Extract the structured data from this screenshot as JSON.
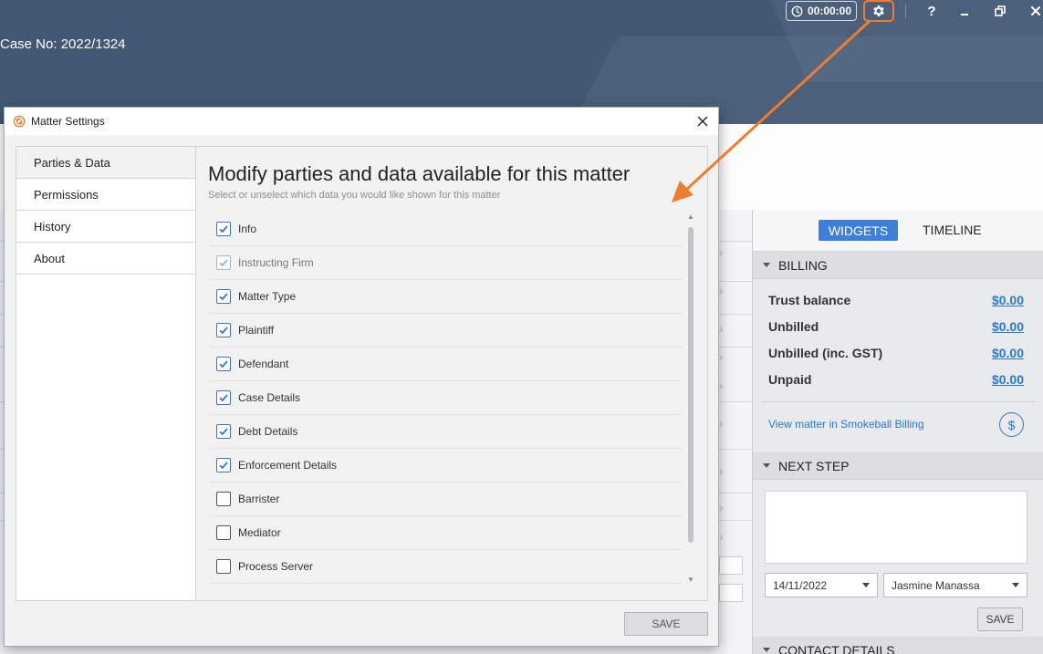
{
  "header": {
    "case_no": "Case No: 2022/1324",
    "timer": "00:00:00",
    "help": "?"
  },
  "dialog": {
    "title": "Matter Settings",
    "nav": [
      {
        "label": "Parties & Data",
        "active": true
      },
      {
        "label": "Permissions"
      },
      {
        "label": "History"
      },
      {
        "label": "About"
      }
    ],
    "heading": "Modify parties and data available for this matter",
    "subheading": "Select or unselect which data you would like shown for this matter",
    "items": [
      {
        "label": "Info",
        "checked": true
      },
      {
        "label": "Instructing Firm",
        "checked": true,
        "disabled": true
      },
      {
        "label": "Matter Type",
        "checked": true
      },
      {
        "label": "Plaintiff",
        "checked": true
      },
      {
        "label": "Defendant",
        "checked": true
      },
      {
        "label": "Case Details",
        "checked": true
      },
      {
        "label": "Debt Details",
        "checked": true
      },
      {
        "label": "Enforcement Details",
        "checked": true
      },
      {
        "label": "Barrister",
        "checked": false
      },
      {
        "label": "Mediator",
        "checked": false
      },
      {
        "label": "Process Server",
        "checked": false
      }
    ],
    "save_label": "SAVE"
  },
  "right_panel": {
    "tab_widgets": "WIDGETS",
    "tab_timeline": "TIMELINE",
    "billing": {
      "title": "BILLING",
      "rows": [
        {
          "label": "Trust balance",
          "value": "$0.00"
        },
        {
          "label": "Unbilled",
          "value": "$0.00"
        },
        {
          "label": "Unbilled (inc. GST)",
          "value": "$0.00"
        },
        {
          "label": "Unpaid",
          "value": "$0.00"
        }
      ],
      "link": "View matter in Smokeball Billing",
      "dollar": "$"
    },
    "next_step": {
      "title": "NEXT STEP",
      "date": "14/11/2022",
      "assignee": "Jasmine Manassa",
      "save_label": "SAVE"
    },
    "contact_title": "CONTACT DETAILS"
  },
  "colors": {
    "header_bg": "#435874",
    "accent_blue": "#3d7fd9",
    "annotation_orange": "#ef7d2e",
    "link_blue": "#2b78d0"
  }
}
